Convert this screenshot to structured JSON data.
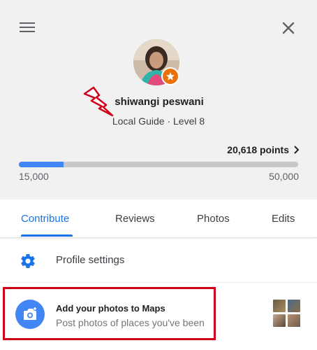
{
  "header": {
    "menu_icon": "hamburger-menu-icon",
    "close_icon": "close-icon",
    "user_name": "shiwangi peswani",
    "level_text": "Local Guide · Level 8",
    "points_text": "20,618 points",
    "progress": {
      "value": 20618,
      "min": 15000,
      "max": 50000,
      "min_label": "15,000",
      "max_label": "50,000"
    },
    "badge_icon": "local-guide-star-badge-icon",
    "annotation_icon": "red-lightning-arrow-icon"
  },
  "tabs": [
    {
      "label": "Contribute",
      "active": true
    },
    {
      "label": "Reviews",
      "active": false
    },
    {
      "label": "Photos",
      "active": false
    },
    {
      "label": "Edits",
      "active": false
    }
  ],
  "settings_row": {
    "icon": "gear-icon",
    "label": "Profile settings"
  },
  "photos_row": {
    "icon": "add-photo-camera-icon",
    "title": "Add your photos to Maps",
    "subtitle": "Post photos of places you've been"
  },
  "colors": {
    "accent": "#1a73e8",
    "progress_fill": "#4285f4",
    "badge": "#e8710a",
    "highlight": "#d0021b",
    "header_bg": "#f1f1f1"
  }
}
